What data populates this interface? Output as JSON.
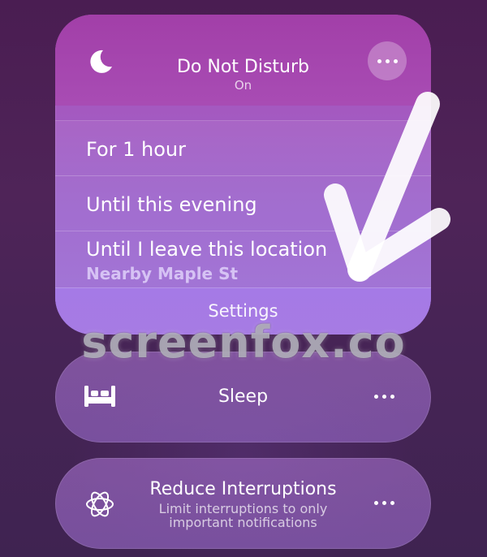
{
  "dnd": {
    "title": "Do Not Disturb",
    "status": "On",
    "options": [
      {
        "label": "For 1 hour"
      },
      {
        "label": "Until this evening"
      },
      {
        "label": "Until I leave this location",
        "detail": "Nearby Maple St"
      }
    ],
    "settings_label": "Settings",
    "icon": "moon-icon",
    "more_icon": "ellipsis-icon"
  },
  "focus_modes": {
    "sleep": {
      "label": "Sleep",
      "icon": "bed-icon"
    },
    "reduce_interruptions": {
      "label": "Reduce Interruptions",
      "subtitle_line1": "Limit interruptions to only",
      "subtitle_line2": "important notifications",
      "icon": "atom-icon"
    }
  },
  "watermark": "screenfox.co",
  "colors": {
    "dnd_header": "#a23fa8",
    "settings_row": "#a57ae6",
    "location_detail": "#d6c2f4",
    "background": "#4a1d52"
  }
}
